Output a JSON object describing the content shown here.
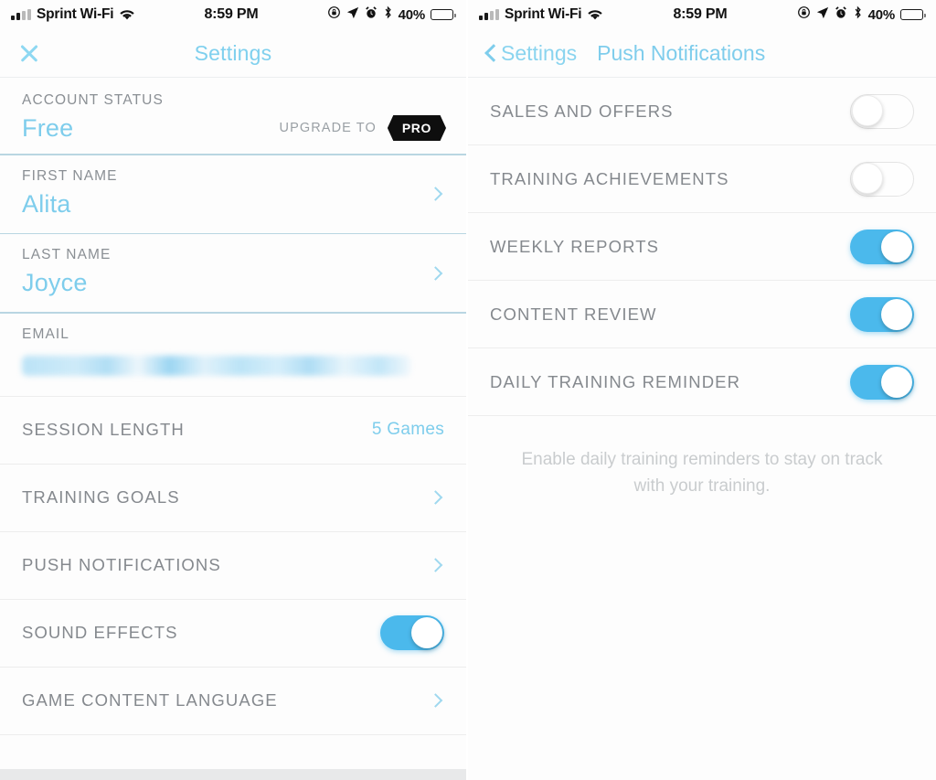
{
  "status_bar": {
    "carrier": "Sprint Wi-Fi",
    "time": "8:59 PM",
    "battery_percent": "40%",
    "icons": [
      "signal-bars",
      "wifi-icon",
      "rotation-lock-icon",
      "location-arrow-icon",
      "alarm-clock-icon",
      "bluetooth-icon",
      "battery-icon"
    ]
  },
  "colors": {
    "accent_blue": "#7ecdec",
    "toggle_on": "#4bb9ec",
    "label_grey": "#85898e",
    "badge_black": "#0e0e0e"
  },
  "left_screen": {
    "nav": {
      "title": "Settings",
      "close_icon": "close-x-icon"
    },
    "account_status": {
      "label": "ACCOUNT STATUS",
      "value": "Free",
      "upgrade_text": "UPGRADE TO",
      "badge": "PRO"
    },
    "first_name": {
      "label": "FIRST NAME",
      "value": "Alita"
    },
    "last_name": {
      "label": "LAST NAME",
      "value": "Joyce"
    },
    "email": {
      "label": "EMAIL",
      "value_redacted": true
    },
    "rows": [
      {
        "label": "SESSION LENGTH",
        "value": "5 Games",
        "control": "value"
      },
      {
        "label": "TRAINING GOALS",
        "control": "chevron"
      },
      {
        "label": "PUSH NOTIFICATIONS",
        "control": "chevron"
      },
      {
        "label": "SOUND EFFECTS",
        "control": "toggle",
        "on": true
      },
      {
        "label": "GAME CONTENT LANGUAGE",
        "control": "chevron"
      }
    ]
  },
  "right_screen": {
    "nav": {
      "back_label": "Settings",
      "title": "Push Notifications",
      "back_icon": "back-chevron-icon"
    },
    "rows": [
      {
        "label": "SALES AND OFFERS",
        "on": false
      },
      {
        "label": "TRAINING ACHIEVEMENTS",
        "on": false
      },
      {
        "label": "WEEKLY REPORTS",
        "on": true
      },
      {
        "label": "CONTENT REVIEW",
        "on": true
      },
      {
        "label": "DAILY TRAINING REMINDER",
        "on": true
      }
    ],
    "footer_note": "Enable daily training reminders to stay on track with your training."
  }
}
